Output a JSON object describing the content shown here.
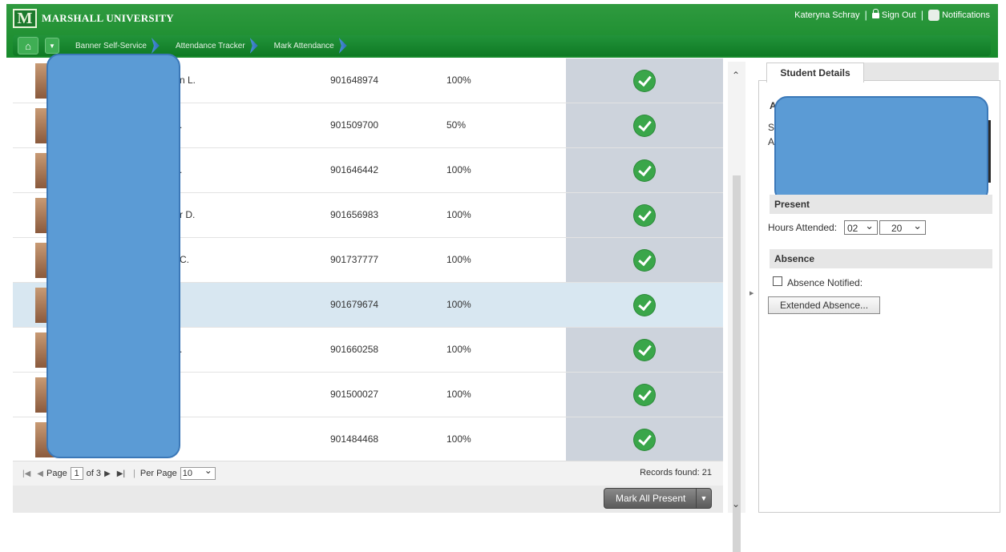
{
  "header": {
    "brand": "MARSHALL UNIVERSITY",
    "logo_letter": "M",
    "user_name": "Kateryna Schray",
    "sign_out": "Sign Out",
    "notifications": "Notifications"
  },
  "breadcrumbs": [
    "Banner Self-Service",
    "Attendance Tracker",
    "Mark Attendance"
  ],
  "table": {
    "rows": [
      {
        "name": "n L.",
        "id": "901648974",
        "percent": "100%",
        "selected": false
      },
      {
        "name": ".",
        "id": "901509700",
        "percent": "50%",
        "selected": false
      },
      {
        "name": ".",
        "id": "901646442",
        "percent": "100%",
        "selected": false
      },
      {
        "name": "r D.",
        "id": "901656983",
        "percent": "100%",
        "selected": false
      },
      {
        "name": "C.",
        "id": "901737777",
        "percent": "100%",
        "selected": false
      },
      {
        "name": "",
        "id": "901679674",
        "percent": "100%",
        "selected": true
      },
      {
        "name": ".",
        "id": "901660258",
        "percent": "100%",
        "selected": false
      },
      {
        "name": "",
        "id": "901500027",
        "percent": "100%",
        "selected": false
      },
      {
        "name": "",
        "id": "901484468",
        "percent": "100%",
        "selected": false
      }
    ]
  },
  "pager": {
    "page_label": "Page",
    "page": "1",
    "of_label": "of 3",
    "per_page_label": "Per Page",
    "per_page": "10",
    "records": "Records found: 21"
  },
  "actions": {
    "mark_all": "Mark All Present"
  },
  "details": {
    "tab": "Student Details",
    "frag_a": "A",
    "frag_s": "S",
    "frag_a2": "A",
    "present_head": "Present",
    "hours_label": "Hours Attended:",
    "hours": "02",
    "minutes": "20",
    "absence_head": "Absence",
    "absence_notified": "Absence Notified:",
    "extended_absence": "Extended Absence..."
  }
}
